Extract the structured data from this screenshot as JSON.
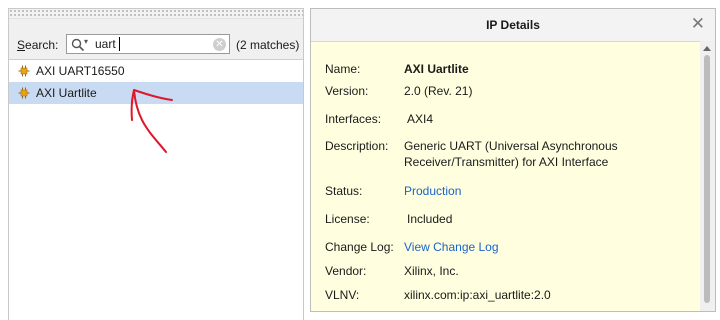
{
  "search": {
    "label": "Search:",
    "query": "uart",
    "match_count": "(2 matches)",
    "icon": "magnifier-icon"
  },
  "results": [
    {
      "label": "AXI UART16550",
      "icon": "ip-core-icon",
      "selected": false
    },
    {
      "label": "AXI Uartlite",
      "icon": "ip-core-icon",
      "selected": true
    }
  ],
  "details_panel": {
    "title": "IP Details",
    "close_icon": "close-icon",
    "fields": {
      "name": {
        "label": "Name:",
        "value": "AXI Uartlite"
      },
      "version": {
        "label": "Version:",
        "value": "2.0 (Rev. 21)"
      },
      "interfaces": {
        "label": "Interfaces:",
        "value": "AXI4"
      },
      "description": {
        "label": "Description:",
        "value": "Generic UART (Universal Asynchronous Receiver/Transmitter) for AXI Interface"
      },
      "status": {
        "label": "Status:",
        "value": "Production"
      },
      "license": {
        "label": "License:",
        "value": "Included"
      },
      "change_log": {
        "label": "Change Log:",
        "value": "View Change Log"
      },
      "vendor": {
        "label": "Vendor:",
        "value": "Xilinx, Inc."
      },
      "vlnv": {
        "label": "VLNV:",
        "value": "xilinx.com:ip:axi_uartlite:2.0"
      }
    }
  },
  "colors": {
    "selection": "#c9dbf2",
    "details_background": "#ffffe0",
    "link": "#1a63c7",
    "annotation": "#e0162b"
  }
}
